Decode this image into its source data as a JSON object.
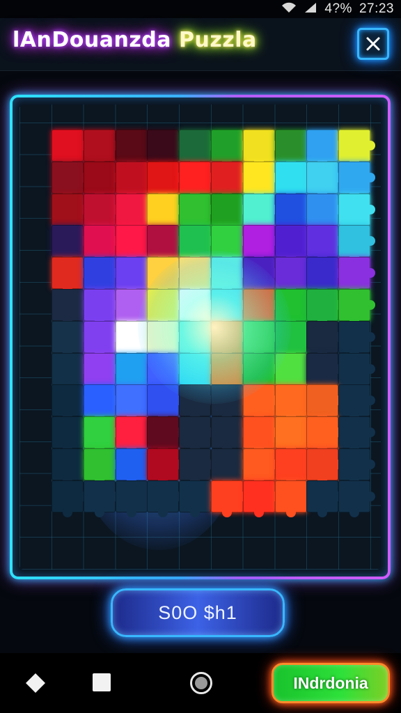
{
  "status_bar": {
    "wifi_icon": "wifi-icon",
    "signal_icon": "signal-icon",
    "battery": "4?%",
    "time": "27:23"
  },
  "header": {
    "title_part1": "lAnDouanzda",
    "title_part2": "Puzzla",
    "close_icon": "close-icon",
    "title_colors": [
      "#c04bff",
      "#ffe95a"
    ]
  },
  "board": {
    "frame_colors": [
      "#2de3ff",
      "#d25bff"
    ],
    "pieces": [
      [
        "#e01020",
        "#b0101e",
        "#5a0a16",
        "#3a0a1a",
        "#1c6a3a",
        "#20a02a",
        "#f0e020",
        "#2a8f2a",
        "#30a0f0",
        "#e0f030"
      ],
      [
        "#8a1020",
        "#9a0a18",
        "#c01020",
        "#e01515",
        "#ff2020",
        "#e02020",
        "#ffe620",
        "#30e0f0",
        "#40d0f0",
        "#30a8f0"
      ],
      [
        "#a0101a",
        "#c01030",
        "#f01840",
        "#ffd020",
        "#30c030",
        "#20a020",
        "#50f0d0",
        "#2050e0",
        "#3090f0",
        "#40e0f0"
      ],
      [
        "#2a1a5a",
        "#e01050",
        "#ff1848",
        "#b01040",
        "#20c050",
        "#30d040",
        "#b020e0",
        "#5020d0",
        "#6030e0",
        "#30c0e0"
      ],
      [
        "#e02a20",
        "#3040e0",
        "#6a40f0",
        "#ffd040",
        "#ffe070",
        "#60f0e0",
        "#4a20c0",
        "#6a2cd8",
        "#3a2acb",
        "#8a30e0"
      ],
      [
        "#1c2a44",
        "#7a40f0",
        "#b060f0",
        "#f0f040",
        "#ffffff",
        "#40e0f0",
        "#f06020",
        "#20c030",
        "#20b040",
        "#30c030"
      ],
      [
        "#16324a",
        "#8040f0",
        "#ffffff",
        "#ffffc0",
        "#60f0e0",
        "#ff8020",
        "#30d040",
        "#20c040",
        "#1a2a40",
        "#12304a"
      ],
      [
        "#123048",
        "#9040f0",
        "#20a0f0",
        "#4060ff",
        "#30e0f0",
        "#f08020",
        "#20c030",
        "#50e040",
        "#1a2a44",
        "#12304a"
      ],
      [
        "#0e2a40",
        "#2a60ff",
        "#4070ff",
        "#3050f0",
        "#1a2a40",
        "#1a2a40",
        "#ff6020",
        "#ff6a20",
        "#f06020",
        "#12304a"
      ],
      [
        "#0e2a40",
        "#30d040",
        "#ff2040",
        "#600a20",
        "#1a2a40",
        "#1a2a40",
        "#ff5020",
        "#ff7020",
        "#ff6020",
        "#12304a"
      ],
      [
        "#0e2a40",
        "#30c030",
        "#2060f0",
        "#b00a20",
        "#1a2a40",
        "#1a2a40",
        "#ff5a20",
        "#ff4020",
        "#f04020",
        "#12304a"
      ],
      [
        "#0e2a40",
        "#12304a",
        "#12304a",
        "#12304a",
        "#12304a",
        "#ff4020",
        "#ff3020",
        "#ff5020",
        "#12304a",
        "#12304a"
      ]
    ]
  },
  "price_pill": {
    "label": "S0O $h1"
  },
  "bottom_bar": {
    "back_icon": "back-diamond-icon",
    "home_icon": "home-square-icon",
    "recent_icon": "recent-circle-icon",
    "action_label": "INdrdonia"
  }
}
